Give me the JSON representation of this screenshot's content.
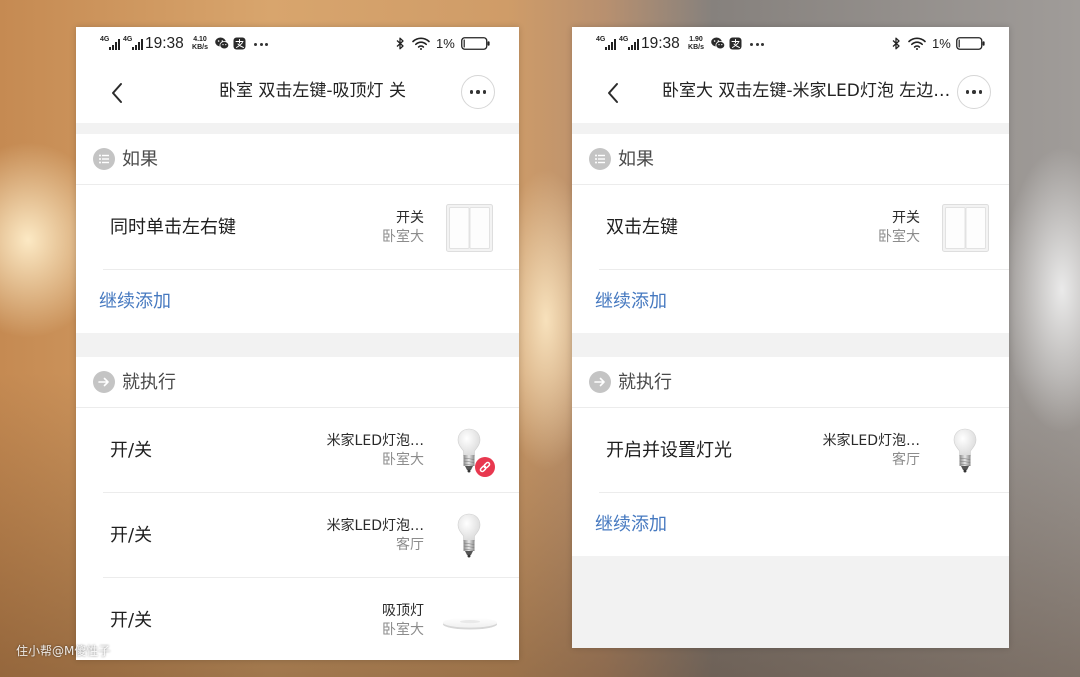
{
  "watermark": "住小帮@M傻性子",
  "colors": {
    "link": "#4679c0",
    "badge": "#e8384f",
    "gap": "#f2f2f2",
    "text_primary": "#1f1f1f",
    "text_secondary": "#8c8c8c"
  },
  "phones": [
    {
      "status_bar": {
        "network_labels": [
          "4G",
          "4G"
        ],
        "time": "19:38",
        "speed_value": "4.10",
        "speed_unit": "KB/s",
        "battery_percent": "1%",
        "icons": [
          "signal-icon",
          "signal-icon",
          "wechat-icon",
          "app-notification-icon",
          "more-notifications-icon",
          "bluetooth-icon",
          "wifi-icon",
          "battery-icon"
        ]
      },
      "header": {
        "title": "卧室 双击左键-吸顶灯 关",
        "icons": [
          "back-chevron-icon",
          "more-icon"
        ]
      },
      "if_section": {
        "label": "如果",
        "icon": "list-icon",
        "conditions": [
          {
            "title": "同时单击左右键",
            "device": "开关",
            "room": "卧室大",
            "icon": "wall-switch-icon"
          }
        ],
        "add_label": "继续添加"
      },
      "then_section": {
        "label": "就执行",
        "icon": "arrow-right-circle-icon",
        "actions": [
          {
            "title": "开/关",
            "device": "米家LED灯泡…",
            "room": "卧室大",
            "icon": "led-bulb-icon",
            "badge_icon": "link-icon"
          },
          {
            "title": "开/关",
            "device": "米家LED灯泡…",
            "room": "客厅",
            "icon": "led-bulb-icon"
          },
          {
            "title": "开/关",
            "device": "吸顶灯",
            "room": "卧室大",
            "icon": "ceiling-light-icon"
          }
        ]
      }
    },
    {
      "status_bar": {
        "network_labels": [
          "4G",
          "4G"
        ],
        "time": "19:38",
        "speed_value": "1.90",
        "speed_unit": "KB/s",
        "battery_percent": "1%",
        "icons": [
          "signal-icon",
          "signal-icon",
          "wechat-icon",
          "app-notification-icon",
          "more-notifications-icon",
          "bluetooth-icon",
          "wifi-icon",
          "battery-icon"
        ]
      },
      "header": {
        "title": "卧室大 双击左键-米家LED灯泡 左边…",
        "icons": [
          "back-chevron-icon",
          "more-icon"
        ]
      },
      "if_section": {
        "label": "如果",
        "icon": "list-icon",
        "conditions": [
          {
            "title": "双击左键",
            "device": "开关",
            "room": "卧室大",
            "icon": "wall-switch-icon"
          }
        ],
        "add_label": "继续添加"
      },
      "then_section": {
        "label": "就执行",
        "icon": "arrow-right-circle-icon",
        "actions": [
          {
            "title": "开启并设置灯光",
            "device": "米家LED灯泡…",
            "room": "客厅",
            "icon": "led-bulb-icon"
          }
        ],
        "add_label": "继续添加"
      }
    }
  ]
}
